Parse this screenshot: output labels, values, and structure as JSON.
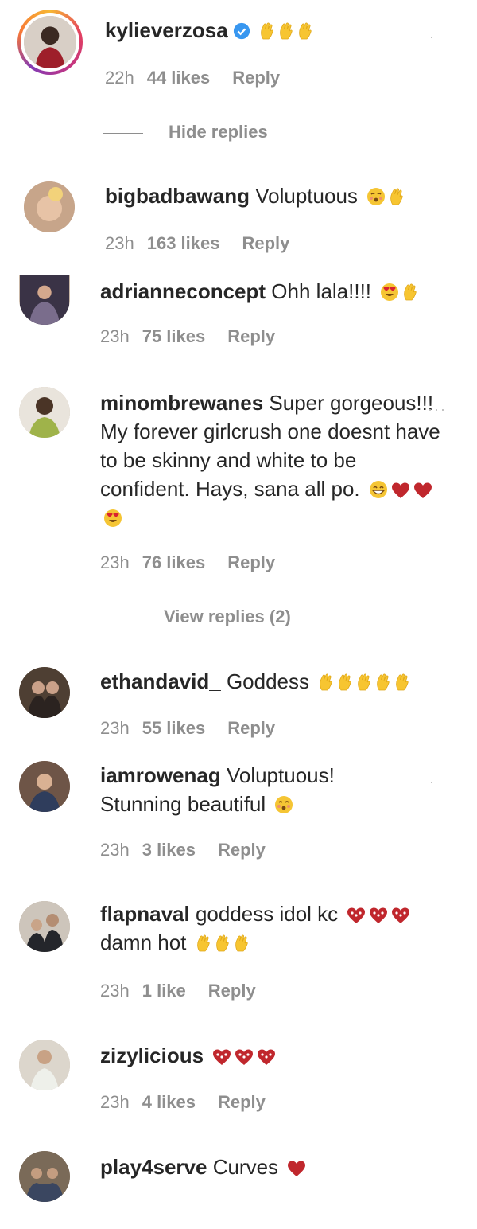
{
  "top_comment": {
    "username": "kylieverzosa",
    "time": "22h",
    "likes": "44 likes",
    "reply": "Reply",
    "hide_replies": "Hide replies"
  },
  "comments": [
    {
      "username": "bigbadbawang",
      "text": "Voluptuous",
      "time": "23h",
      "likes": "163 likes",
      "reply": "Reply"
    },
    {
      "username": "adrianneconcept",
      "text": "Ohh lala!!!!",
      "time": "23h",
      "likes": "75 likes",
      "reply": "Reply"
    },
    {
      "username": "minombrewanes",
      "text": "Super gorgeous!!! My forever girlcrush one doesnt have to be skinny and white to be confident. Hays, sana all po.",
      "time": "23h",
      "likes": "76 likes",
      "reply": "Reply",
      "view_replies": "View replies (2)"
    },
    {
      "username": "ethandavid_",
      "text": "Goddess",
      "time": "23h",
      "likes": "55 likes",
      "reply": "Reply"
    },
    {
      "username": "iamrowenag",
      "text": "Voluptuous! Stunning beautiful",
      "time": "23h",
      "likes": "3 likes",
      "reply": "Reply"
    },
    {
      "username": "flapnaval",
      "text": "goddess idol kc",
      "text2": "damn hot",
      "time": "23h",
      "likes": "1 like",
      "reply": "Reply"
    },
    {
      "username": "zizylicious",
      "text": "",
      "time": "23h",
      "likes": "4 likes",
      "reply": "Reply"
    },
    {
      "username": "play4serve",
      "text": "Curves",
      "time": "",
      "likes": "",
      "reply": ""
    }
  ],
  "icons": {
    "more": "more-options-icon",
    "verified": "verified-badge-icon",
    "clap": "raised-hands-emoji",
    "heart": "red-heart-emoji",
    "heart_sparkle": "sparkling-heart-emoji",
    "kiss": "kissing-face-emoji",
    "heart_eyes": "heart-eyes-emoji",
    "grin": "grinning-face-emoji"
  }
}
